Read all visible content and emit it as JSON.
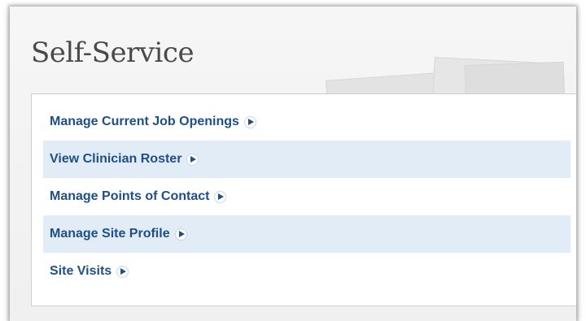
{
  "panel": {
    "title": "Self-Service"
  },
  "menu": {
    "items": [
      {
        "label": "Manage Current Job Openings"
      },
      {
        "label": "View Clinician Roster"
      },
      {
        "label": "Manage Points of Contact"
      },
      {
        "label": "Manage Site Profile"
      },
      {
        "label": "Site Visits"
      }
    ]
  },
  "colors": {
    "link": "#1e4f86",
    "row_highlight": "#e1ecf7",
    "title": "#4a4a4a"
  },
  "icons": {
    "item_arrow": "play-arrow-icon"
  }
}
